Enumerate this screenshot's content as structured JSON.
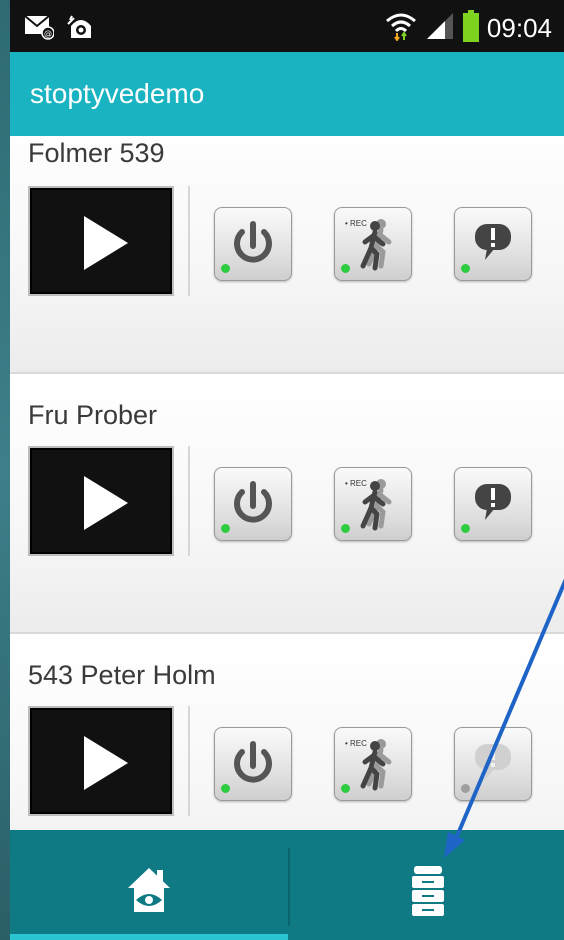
{
  "statusbar": {
    "time": "09:04",
    "icons": [
      "mail-icon",
      "camera-notification-icon",
      "wifi-icon",
      "signal-icon",
      "battery-icon"
    ]
  },
  "appbar": {
    "title": "stoptyvedemo"
  },
  "devices": [
    {
      "name": "Folmer 539",
      "controls": [
        {
          "icon": "power-icon",
          "led": "#2ecc40"
        },
        {
          "icon": "motion-record-icon",
          "led": "#2ecc40"
        },
        {
          "icon": "alert-icon",
          "led": "#2ecc40"
        }
      ]
    },
    {
      "name": "Fru Prober",
      "controls": [
        {
          "icon": "power-icon",
          "led": "#2ecc40"
        },
        {
          "icon": "motion-record-icon",
          "led": "#2ecc40"
        },
        {
          "icon": "alert-icon",
          "led": "#2ecc40"
        }
      ]
    },
    {
      "name": "543 Peter Holm",
      "controls": [
        {
          "icon": "power-icon",
          "led": "#2ecc40"
        },
        {
          "icon": "motion-record-icon",
          "led": "#2ecc40"
        },
        {
          "icon": "alert-icon",
          "led": "#9e9e9e"
        }
      ]
    }
  ],
  "rec_label": "• REC",
  "bottomnav": {
    "items": [
      "home-eye-icon",
      "device-list-icon"
    ],
    "active": 0
  },
  "colors": {
    "accent": "#1ab3c1",
    "nav_bg": "#0f7a84",
    "led_on": "#2ecc40",
    "led_off": "#9e9e9e",
    "annotation_arrow": "#1e63c6"
  }
}
